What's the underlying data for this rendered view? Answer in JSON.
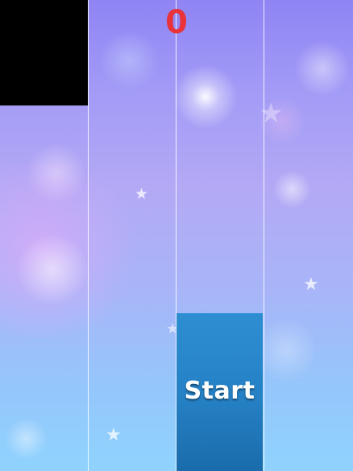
{
  "game": {
    "score": "0",
    "start_label": "Start"
  },
  "icons": {
    "star": "star-icon"
  },
  "colors": {
    "score": "#e8333b",
    "black_tile": "#000000",
    "start_tile": "#2580c4",
    "lane_line": "#ffffff"
  }
}
